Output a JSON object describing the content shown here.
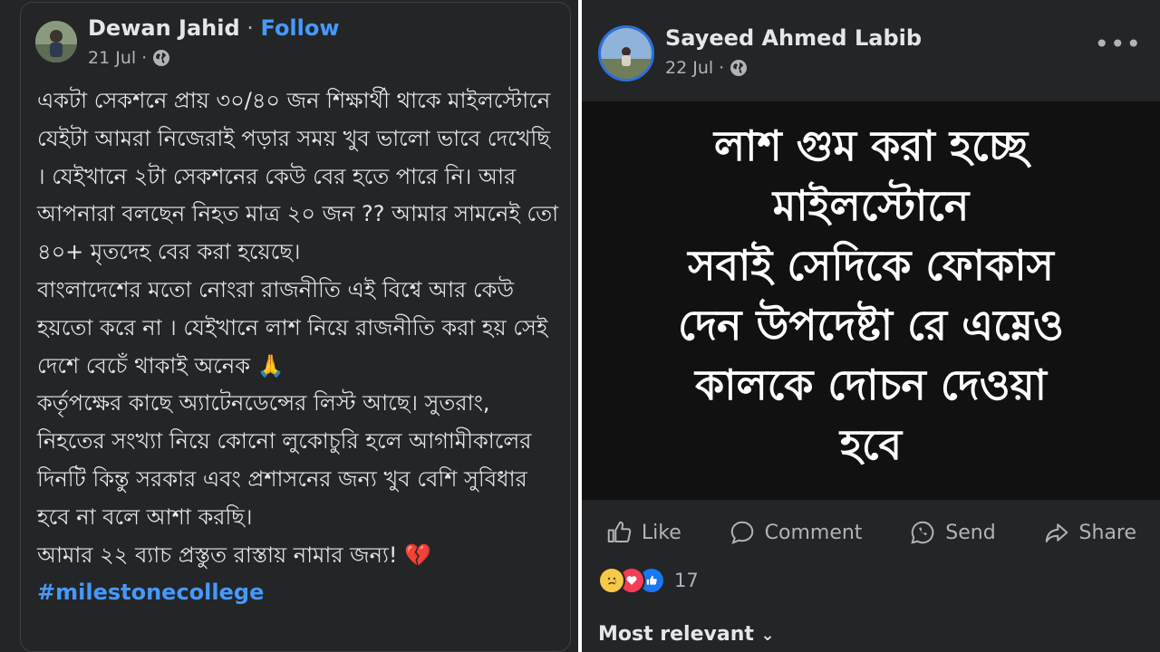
{
  "left_post": {
    "author": "Dewan Jahid",
    "separator": " · ",
    "follow_label": "Follow",
    "date": "21 Jul ·",
    "paragraphs": [
      "একটা সেকশনে প্রায় ৩০/৪০ জন শিক্ষার্থী থাকে মাইলস্টোনে যেইটা আমরা নিজেরাই পড়ার সময় খুব ভালো ভাবে দেখেছি । যেইখানে ২টা সেকশনের কেউ বের হতে পারে নি। আর আপনারা বলছেন নিহত মাত্র ২০ জন ?? আমার সামনেই তো ৪০+ মৃতদেহ বের করা হয়েছে।",
      "বাংলাদেশের মতো নোংরা রাজনীতি এই বিশ্বে আর কেউ হয়তো করে না । যেইখানে লাশ নিয়ে রাজনীতি করা হয় সেই দেশে বেচেঁ থাকাই অনেক 🙏",
      "কর্তৃপক্ষের কাছে অ্যাটেনডেন্সের লিস্ট আছে। সুতরাং, নিহতের সংখ্যা নিয়ে কোনো লুকোচুরি হলে আগামীকালের দিনটি কিন্তু সরকার এবং প্রশাসনের জন্য খুব বেশি সুবিধার হবে না বলে আশা করছি।",
      "আমার ২২ ব্যাচ প্রস্তুত রাস্তায় নামার জন্য! 💔"
    ],
    "hashtag": "#milestonecollege"
  },
  "right_post": {
    "author": "Sayeed Ahmed Labib",
    "date": "22 Jul ·",
    "more_label": "•••",
    "image_lines": [
      "লাশ গুম করা হচ্ছে",
      "মাইলস্টোনে",
      "সবাই সেদিকে ফোকাস",
      "দেন উপদেষ্টা রে এম্নেও",
      "কালকে দোচন দেওয়া",
      "হবে"
    ],
    "actions": {
      "like": "Like",
      "comment": "Comment",
      "send": "Send",
      "share": "Share"
    },
    "reaction_count": "17",
    "sort_label": "Most relevant",
    "sort_chevron": "⌄"
  },
  "colors": {
    "panel_bg": "#242526",
    "image_bg": "#111112",
    "text": "#e4e6eb",
    "secondary": "#b0b3b8",
    "link": "#4599ff"
  }
}
